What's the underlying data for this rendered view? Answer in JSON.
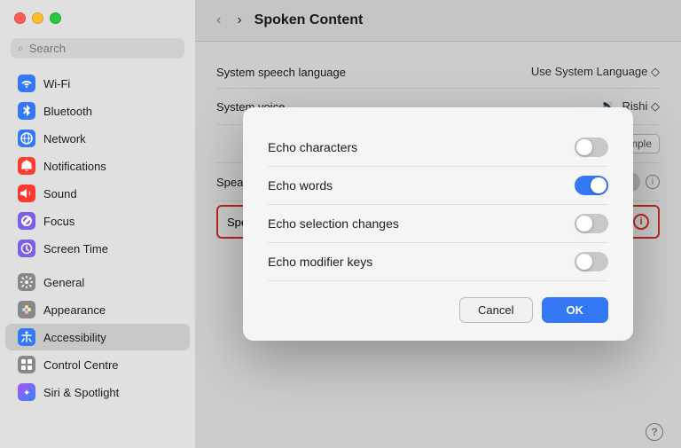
{
  "window": {
    "traffic_lights": [
      "red",
      "yellow",
      "green"
    ]
  },
  "sidebar": {
    "search_placeholder": "Search",
    "items": [
      {
        "id": "wifi",
        "label": "Wi-Fi",
        "icon": "wifi",
        "active": false
      },
      {
        "id": "bluetooth",
        "label": "Bluetooth",
        "icon": "bluetooth",
        "active": false
      },
      {
        "id": "network",
        "label": "Network",
        "icon": "network",
        "active": false
      },
      {
        "id": "notifications",
        "label": "Notifications",
        "icon": "notifications",
        "active": false
      },
      {
        "id": "sound",
        "label": "Sound",
        "icon": "sound",
        "active": false
      },
      {
        "id": "focus",
        "label": "Focus",
        "icon": "focus",
        "active": false
      },
      {
        "id": "screentime",
        "label": "Screen Time",
        "icon": "screentime",
        "active": false
      },
      {
        "id": "general",
        "label": "General",
        "icon": "general",
        "active": false
      },
      {
        "id": "appearance",
        "label": "Appearance",
        "icon": "appearance",
        "active": false
      },
      {
        "id": "accessibility",
        "label": "Accessibility",
        "icon": "accessibility",
        "active": true
      },
      {
        "id": "controlcentre",
        "label": "Control Centre",
        "icon": "controlcentre",
        "active": false
      },
      {
        "id": "siri",
        "label": "Siri & Spotlight",
        "icon": "siri",
        "active": false
      }
    ]
  },
  "header": {
    "back_label": "‹",
    "forward_label": "›",
    "title": "Spoken Content"
  },
  "content": {
    "rows": [
      {
        "id": "system-speech-language",
        "label": "System speech language",
        "value": "Use System Language ◇",
        "type": "select"
      },
      {
        "id": "system-voice",
        "label": "System voice",
        "value": "Rishi ◇",
        "type": "select"
      }
    ],
    "rows2": [
      {
        "id": "speak-item",
        "label": "Speak item under the pointer",
        "type": "toggle",
        "on": false,
        "hasInfo": true
      },
      {
        "id": "speak-typing",
        "label": "Speak typing feedback",
        "type": "toggle",
        "on": false,
        "hasInfo": true,
        "highlighted": true
      }
    ],
    "play_sample": "Play Sample",
    "volume_label": ""
  },
  "modal": {
    "title": "",
    "rows": [
      {
        "id": "echo-characters",
        "label": "Echo characters",
        "type": "toggle",
        "on": false
      },
      {
        "id": "echo-words",
        "label": "Echo words",
        "type": "toggle",
        "on": true
      },
      {
        "id": "echo-selection",
        "label": "Echo selection changes",
        "type": "toggle",
        "on": false
      },
      {
        "id": "echo-modifier",
        "label": "Echo modifier keys",
        "type": "toggle",
        "on": false
      }
    ],
    "cancel_label": "Cancel",
    "ok_label": "OK"
  },
  "bottom": {
    "help_label": "?"
  },
  "icons": {
    "wifi": "📶",
    "bluetooth": "🔵",
    "network": "🌐",
    "notifications": "🔔",
    "sound": "🔊",
    "focus": "🌙",
    "screentime": "⏱",
    "general": "⚙️",
    "appearance": "🎨",
    "accessibility": "♿",
    "controlcentre": "⊞",
    "siri": "✦",
    "search": "🔍"
  }
}
